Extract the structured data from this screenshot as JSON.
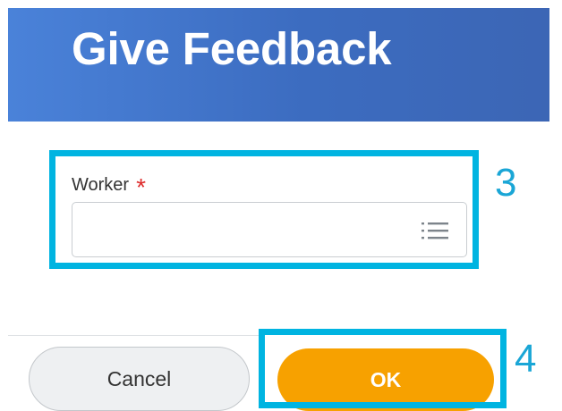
{
  "dialog": {
    "title": "Give Feedback"
  },
  "form": {
    "worker_label": "Worker",
    "required_marker": "*",
    "worker_value": "",
    "worker_icon": "list-icon"
  },
  "buttons": {
    "cancel_label": "Cancel",
    "ok_label": "OK"
  },
  "annotations": {
    "step_worker": "3",
    "step_ok": "4",
    "highlight_color": "#00b4e1"
  },
  "colors": {
    "header_start": "#4a82d9",
    "header_end": "#3c66b5",
    "ok_button": "#f7a100",
    "required": "#de2d2d"
  }
}
